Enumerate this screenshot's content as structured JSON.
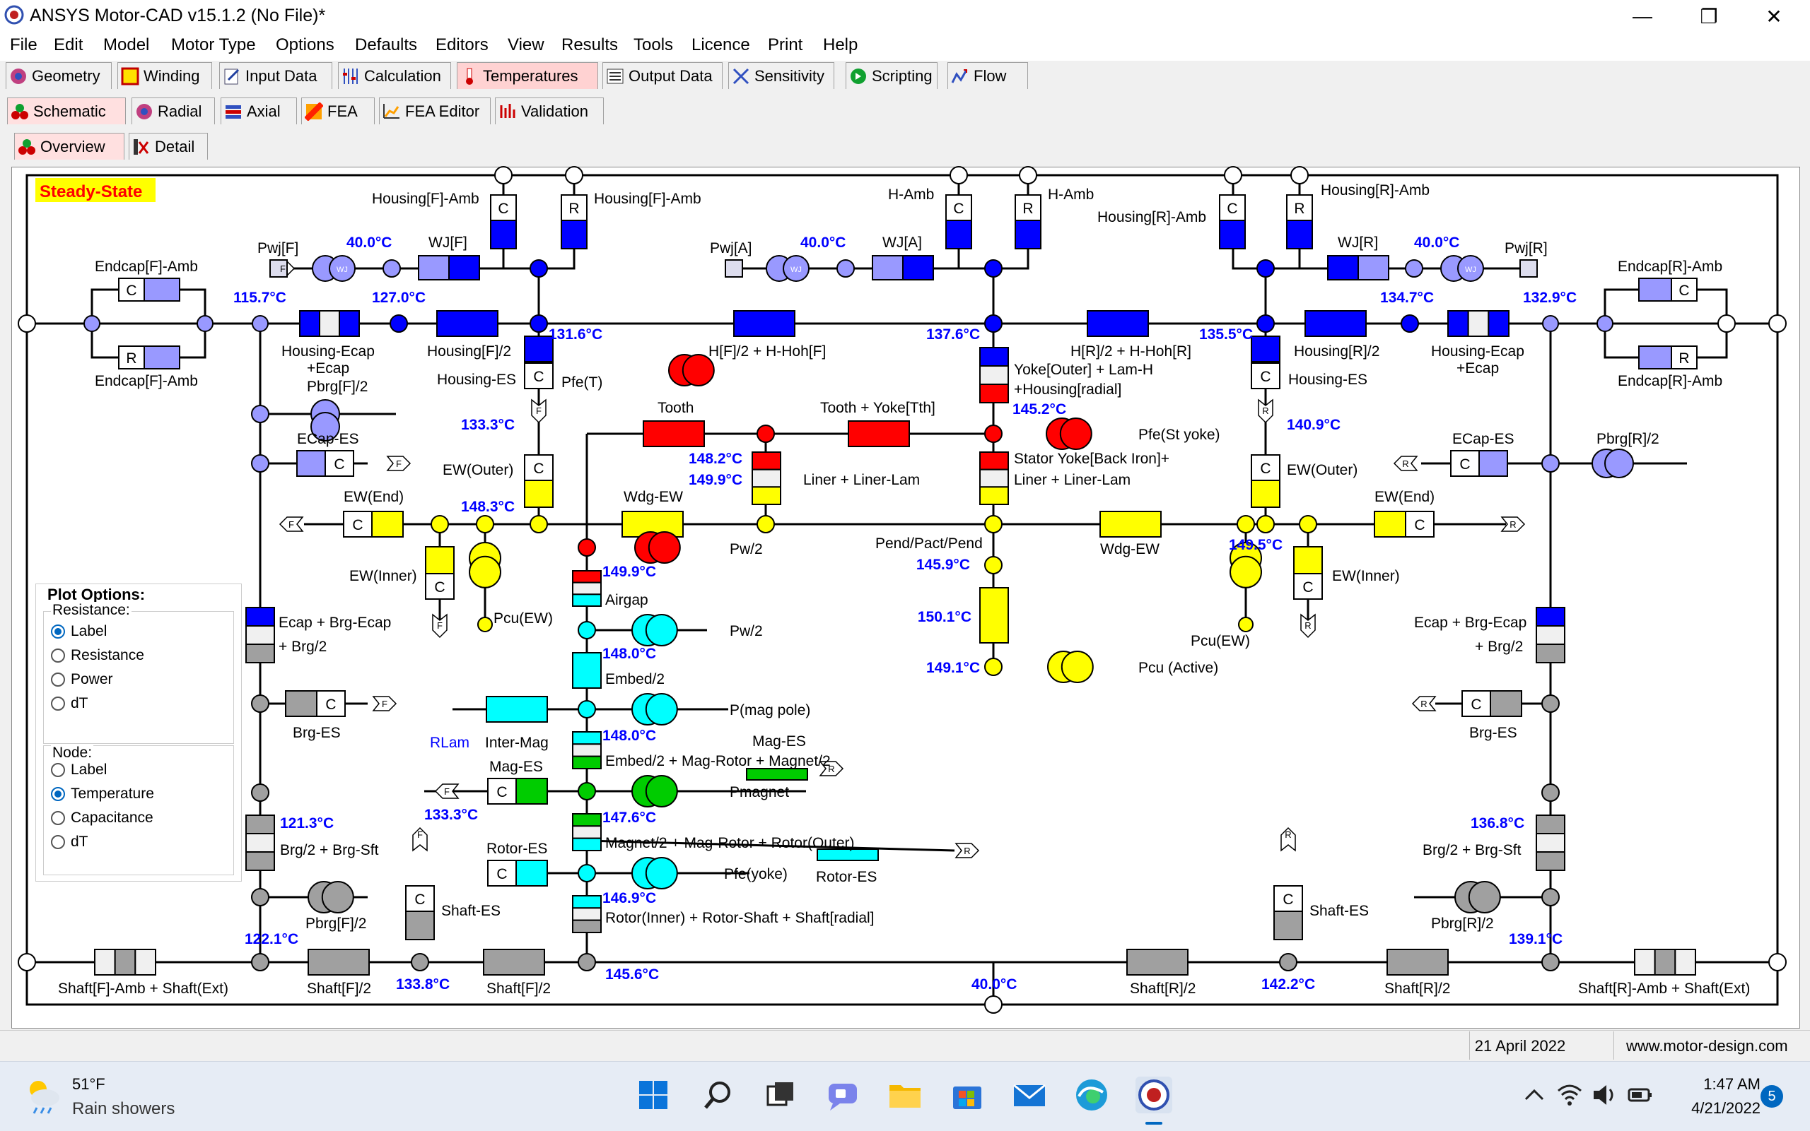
{
  "window": {
    "title": "ANSYS Motor-CAD v15.1.2 (No File)*"
  },
  "menu": [
    "File",
    "Edit",
    "Model",
    "Motor Type",
    "Options",
    "Defaults",
    "Editors",
    "View",
    "Results",
    "Tools",
    "Licence",
    "Print",
    "Help"
  ],
  "main_tabs": [
    "Geometry",
    "Winding",
    "Input Data",
    "Calculation",
    "Temperatures",
    "Output Data",
    "Sensitivity",
    "Scripting",
    "Flow"
  ],
  "sub_tabs": [
    "Schematic",
    "Radial",
    "Axial",
    "FEA",
    "FEA Editor",
    "Validation"
  ],
  "view_tabs": [
    "Overview",
    "Detail"
  ],
  "schematic": {
    "mode_label": "Steady-State",
    "node_letters": {
      "c": "C",
      "r": "R",
      "f": "F",
      "wj": "WJ"
    },
    "labels": {
      "housing_f_amb": "Housing[F]-Amb",
      "h_amb": "H-Amb",
      "housing_r_amb": "Housing[R]-Amb",
      "pwj_f": "Pwj[F]",
      "pwj_a": "Pwj[A]",
      "pwj_r": "Pwj[R]",
      "wj_f": "WJ[F]",
      "wj_a": "WJ[A]",
      "wj_r": "WJ[R]",
      "endcap_f_amb": "Endcap[F]-Amb",
      "endcap_r_amb": "Endcap[R]-Amb",
      "housing_ecap_line1": "Housing-Ecap",
      "housing_ecap_line2": "+Ecap",
      "housing_f_2": "Housing[F]/2",
      "housing_r_2": "Housing[R]/2",
      "housing_es": "Housing-ES",
      "pfe_t": "Pfe(T)",
      "h_f_hohf": "H[F]/2 + H-Hoh[F]",
      "h_r_hohr": "H[R]/2 + H-Hoh[R]",
      "yoke_outer_line1": "Yoke[Outer] + Lam-H",
      "yoke_outer_line2": "+Housing[radial]",
      "pbrg_f_2": "Pbrg[F]/2",
      "pbrg_r_2": "Pbrg[R]/2",
      "tooth": "Tooth",
      "tooth_yoke": "Tooth + Yoke[Tth]",
      "pfe_st_yoke": "Pfe(St yoke)",
      "ecap_es": "ECap-ES",
      "ew_outer": "EW(Outer)",
      "liner_lam": "Liner + Liner-Lam",
      "stator_yoke_line1": "Stator Yoke[Back Iron]+",
      "stator_yoke_line2": "Liner + Liner-Lam",
      "ew_end": "EW(End)",
      "wdg_ew": "Wdg-EW",
      "pw_2": "Pw/2",
      "pend_pact": "Pend/Pact/Pend",
      "ew_inner": "EW(Inner)",
      "airgap": "Airgap",
      "pcu_ew": "Pcu(EW)",
      "ecap_brg_ecap": "Ecap + Brg-Ecap",
      "brg_2": "+ Brg/2",
      "embed_2": "Embed/2",
      "pcu_active": "Pcu (Active)",
      "p_mag_pole": "P(mag pole)",
      "brg_es": "Brg-ES",
      "rlam": "RLam",
      "inter_mag": "Inter-Mag",
      "mag_es": "Mag-ES",
      "embed_mag_rotor": "Embed/2 + Mag-Rotor + Magnet/2",
      "pmagnet": "Pmagnet",
      "magnet_mag_rotor": "Magnet/2 + Mag-Rotor + Rotor(Outer)",
      "brg2_brg_sft": "Brg/2 + Brg-Sft",
      "rotor_es": "Rotor-ES",
      "pfe_yoke": "Pfe(yoke)",
      "shaft_es": "Shaft-ES",
      "rotor_inner": "Rotor(Inner) + Rotor-Shaft + Shaft[radial]",
      "shaft_f_amb": "Shaft[F]-Amb + Shaft(Ext)",
      "shaft_f_2": "Shaft[F]/2",
      "shaft_r_2": "Shaft[R]/2",
      "shaft_r_amb": "Shaft[R]-Amb + Shaft(Ext)"
    },
    "temps": {
      "t_wj_f": "40.0°C",
      "t_wj_a": "40.0°C",
      "t_wj_r": "40.0°C",
      "t_115_7": "115.7°C",
      "t_127_0": "127.0°C",
      "t_131_6": "131.6°C",
      "t_137_6": "137.6°C",
      "t_135_5": "135.5°C",
      "t_134_7": "134.7°C",
      "t_132_9": "132.9°C",
      "t_133_3a": "133.3°C",
      "t_145_2": "145.2°C",
      "t_140_9a": "140.9°C",
      "t_148_2": "148.2°C",
      "t_149_9a": "149.9°C",
      "t_148_3": "148.3°C",
      "t_149_9b": "149.9°C",
      "t_145_9": "145.9°C",
      "t_149_5": "149.5°C",
      "t_150_1": "150.1°C",
      "t_140_9b": "140.9°C",
      "t_148_0a": "148.0°C",
      "t_149_1": "149.1°C",
      "t_148_0b": "148.0°C",
      "t_133_3b": "133.3°C",
      "t_121_3": "121.3°C",
      "t_147_6": "147.6°C",
      "t_136_8": "136.8°C",
      "t_146_9": "146.9°C",
      "t_122_1": "122.1°C",
      "t_139_1": "139.1°C",
      "t_133_8": "133.8°C",
      "t_145_6": "145.6°C",
      "t_40_0": "40.0°C",
      "t_142_2": "142.2°C"
    }
  },
  "plot_options": {
    "title": "Plot Options:",
    "resistance_label": "Resistance:",
    "resistance_opts": [
      "Label",
      "Resistance",
      "Power",
      "dT"
    ],
    "resistance_selected": 0,
    "node_label": "Node:",
    "node_opts": [
      "Label",
      "Temperature",
      "Capacitance",
      "dT"
    ],
    "node_selected": 1
  },
  "status": {
    "date": "21 April 2022",
    "url": "www.motor-design.com"
  },
  "taskbar": {
    "weather_temp": "51°F",
    "weather_desc": "Rain showers",
    "time": "1:47 AM",
    "date": "4/21/2022",
    "notifications": "5"
  },
  "colors": {
    "blue": "#0000ff",
    "red": "#ff0000",
    "yellow": "#ffff00",
    "cyan": "#00ffff",
    "green": "#00cc00",
    "gray": "#a0a0a0",
    "lavender": "#9999ff",
    "temp_text": "#0000ff",
    "steady_bg": "#ffff00",
    "steady_text": "#ff0000"
  }
}
